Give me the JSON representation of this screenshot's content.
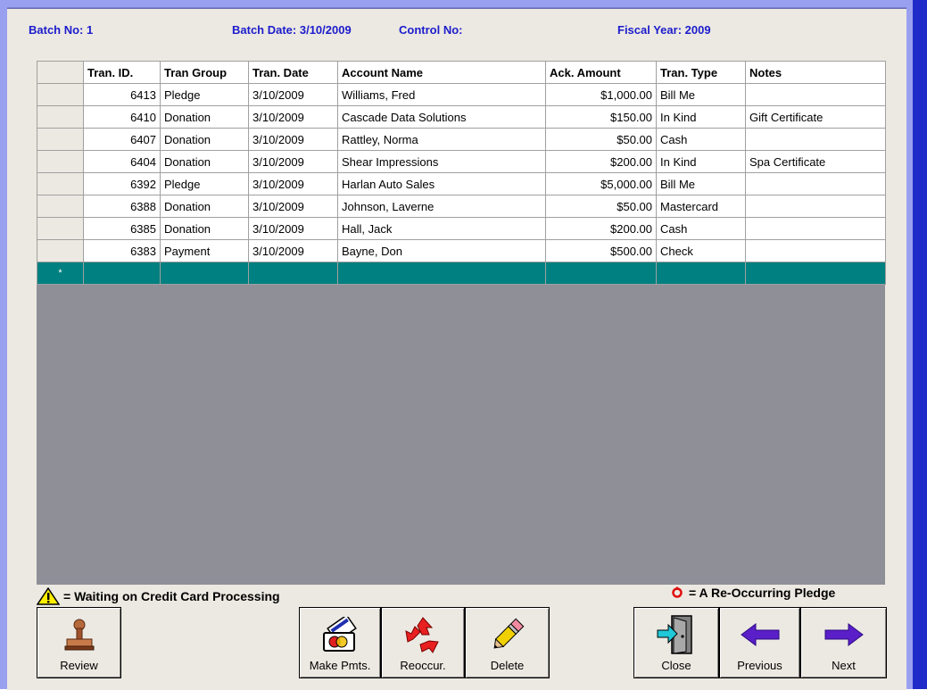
{
  "header": {
    "batch_no": "Batch No: 1",
    "batch_date": "Batch Date: 3/10/2009",
    "control_no": "Control No:",
    "fiscal_year": "Fiscal Year: 2009"
  },
  "table": {
    "columns": [
      "Tran. ID.",
      "Tran Group",
      "Tran. Date",
      "Account Name",
      "Ack. Amount",
      "Tran. Type",
      "Notes"
    ],
    "rows": [
      [
        "6413",
        "Pledge",
        "3/10/2009",
        "Williams, Fred",
        "$1,000.00",
        "Bill Me",
        ""
      ],
      [
        "6410",
        "Donation",
        "3/10/2009",
        "Cascade Data Solutions",
        "$150.00",
        "In Kind",
        "Gift Certificate"
      ],
      [
        "6407",
        "Donation",
        "3/10/2009",
        "Rattley, Norma",
        "$50.00",
        "Cash",
        ""
      ],
      [
        "6404",
        "Donation",
        "3/10/2009",
        "Shear Impressions",
        "$200.00",
        "In Kind",
        "Spa Certificate"
      ],
      [
        "6392",
        "Pledge",
        "3/10/2009",
        "Harlan Auto Sales",
        "$5,000.00",
        "Bill Me",
        ""
      ],
      [
        "6388",
        "Donation",
        "3/10/2009",
        "Johnson, Laverne",
        "$50.00",
        "Mastercard",
        ""
      ],
      [
        "6385",
        "Donation",
        "3/10/2009",
        "Hall, Jack",
        "$200.00",
        "Cash",
        ""
      ],
      [
        "6383",
        "Payment",
        "3/10/2009",
        "Bayne, Don",
        "$500.00",
        "Check",
        ""
      ]
    ],
    "new_row_marker": "*"
  },
  "legend": {
    "warning_text": "= Waiting on Credit Card Processing",
    "recurring_text": "= A Re-Occurring Pledge"
  },
  "buttons": {
    "review": "Review",
    "make_pmts": "Make Pmts.",
    "reoccur": "Reoccur.",
    "delete": "Delete",
    "close": "Close",
    "previous": "Previous",
    "next": "Next"
  },
  "colors": {
    "header_text": "#1c1ccc",
    "new_row": "#008080",
    "grid_empty": "#8f8f98",
    "arrow": "#5a1fc8"
  }
}
